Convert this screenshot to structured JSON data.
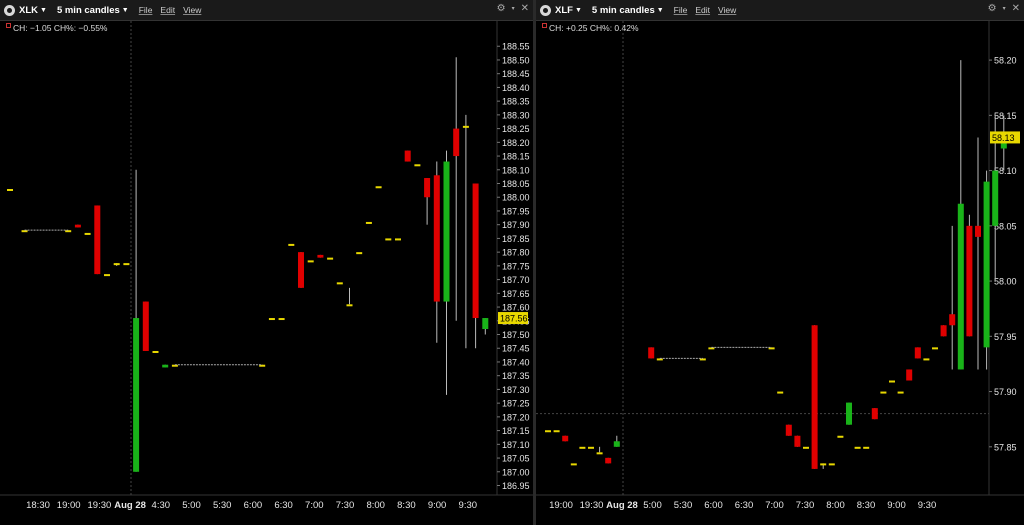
{
  "left_panel": {
    "symbol": "XLK",
    "period": "5 min candles",
    "menu": [
      "File",
      "Edit",
      "View"
    ],
    "change_text": "CH: −1.05 CH%: −0.55%",
    "last_price_label": "187.56",
    "y_ticks": [
      "188.55",
      "188.50",
      "188.45",
      "188.40",
      "188.35",
      "188.30",
      "188.25",
      "188.20",
      "188.15",
      "188.10",
      "188.05",
      "188.00",
      "187.95",
      "187.90",
      "187.85",
      "187.80",
      "187.75",
      "187.70",
      "187.65",
      "187.60",
      "187.55",
      "187.50",
      "187.45",
      "187.40",
      "187.35",
      "187.30",
      "187.25",
      "187.20",
      "187.15",
      "187.10",
      "187.05",
      "187.00",
      "186.95"
    ],
    "x_ticks": [
      "18:30",
      "19:00",
      "19:30",
      "Aug 28",
      "4:30",
      "5:00",
      "5:30",
      "6:00",
      "6:30",
      "7:00",
      "7:30",
      "8:00",
      "8:30",
      "9:00",
      "9:30"
    ]
  },
  "right_panel": {
    "symbol": "XLF",
    "period": "5 min candles",
    "menu": [
      "File",
      "Edit",
      "View"
    ],
    "change_text": "CH: +0.25 CH%: 0.42%",
    "last_price_label": "58.13",
    "y_ticks": [
      "58.20",
      "58.15",
      "58.10",
      "58.05",
      "58.00",
      "57.95",
      "57.90",
      "57.85"
    ],
    "x_ticks": [
      "19:00",
      "19:30",
      "Aug 28",
      "5:00",
      "5:30",
      "6:00",
      "6:30",
      "7:00",
      "7:30",
      "8:00",
      "8:30",
      "9:00",
      "9:30"
    ]
  },
  "colors": {
    "up": "#19b319",
    "down": "#e00000",
    "flat": "#e8d800",
    "last_price_bg": "#e8d800",
    "background": "#000000"
  },
  "icons": {
    "app": "app-logo-icon",
    "settings": "gear-icon",
    "close": "close-icon"
  },
  "chart_data": [
    {
      "type": "candlestick",
      "title": "XLK",
      "series": [
        {
          "name": "XLK",
          "values": [
            {
              "t": 0.0,
              "o": 188.03,
              "h": 188.03,
              "l": 188.03,
              "c": 188.03
            },
            {
              "t": 1.5,
              "o": 187.88,
              "h": 187.88,
              "l": 187.88,
              "c": 187.88
            },
            {
              "t": 6.0,
              "o": 187.88,
              "h": 187.88,
              "l": 187.88,
              "c": 187.88
            },
            {
              "t": 7.0,
              "o": 187.9,
              "h": 187.9,
              "l": 187.89,
              "c": 187.89
            },
            {
              "t": 8.0,
              "o": 187.87,
              "h": 187.87,
              "l": 187.87,
              "c": 187.87
            },
            {
              "t": 9.0,
              "o": 187.97,
              "h": 187.97,
              "l": 187.72,
              "c": 187.72
            },
            {
              "t": 10.0,
              "o": 187.72,
              "h": 187.72,
              "l": 187.72,
              "c": 187.72
            },
            {
              "t": 11.0,
              "o": 187.76,
              "h": 187.76,
              "l": 187.75,
              "c": 187.76
            },
            {
              "t": 12.0,
              "o": 187.76,
              "h": 187.76,
              "l": 187.76,
              "c": 187.76
            },
            {
              "t": 13.0,
              "o": 187.0,
              "h": 188.1,
              "l": 187.0,
              "c": 187.56
            },
            {
              "t": 14.0,
              "o": 187.62,
              "h": 187.62,
              "l": 187.44,
              "c": 187.44
            },
            {
              "t": 15.0,
              "o": 187.44,
              "h": 187.44,
              "l": 187.44,
              "c": 187.44
            },
            {
              "t": 16.0,
              "o": 187.38,
              "h": 187.39,
              "l": 187.38,
              "c": 187.39
            },
            {
              "t": 17.0,
              "o": 187.39,
              "h": 187.39,
              "l": 187.39,
              "c": 187.39
            },
            {
              "t": 26.0,
              "o": 187.39,
              "h": 187.39,
              "l": 187.39,
              "c": 187.39
            },
            {
              "t": 27.0,
              "o": 187.56,
              "h": 187.56,
              "l": 187.56,
              "c": 187.56
            },
            {
              "t": 28.0,
              "o": 187.56,
              "h": 187.56,
              "l": 187.56,
              "c": 187.56
            },
            {
              "t": 29.0,
              "o": 187.83,
              "h": 187.83,
              "l": 187.83,
              "c": 187.83
            },
            {
              "t": 30.0,
              "o": 187.8,
              "h": 187.8,
              "l": 187.67,
              "c": 187.67
            },
            {
              "t": 31.0,
              "o": 187.77,
              "h": 187.77,
              "l": 187.77,
              "c": 187.77
            },
            {
              "t": 32.0,
              "o": 187.79,
              "h": 187.79,
              "l": 187.78,
              "c": 187.78
            },
            {
              "t": 33.0,
              "o": 187.78,
              "h": 187.78,
              "l": 187.78,
              "c": 187.78
            },
            {
              "t": 34.0,
              "o": 187.69,
              "h": 187.69,
              "l": 187.69,
              "c": 187.69
            },
            {
              "t": 35.0,
              "o": 187.61,
              "h": 187.67,
              "l": 187.61,
              "c": 187.61
            },
            {
              "t": 36.0,
              "o": 187.8,
              "h": 187.8,
              "l": 187.8,
              "c": 187.8
            },
            {
              "t": 37.0,
              "o": 187.91,
              "h": 187.91,
              "l": 187.91,
              "c": 187.91
            },
            {
              "t": 38.0,
              "o": 188.04,
              "h": 188.04,
              "l": 188.04,
              "c": 188.04
            },
            {
              "t": 39.0,
              "o": 187.85,
              "h": 187.85,
              "l": 187.85,
              "c": 187.85
            },
            {
              "t": 40.0,
              "o": 187.85,
              "h": 187.85,
              "l": 187.85,
              "c": 187.85
            },
            {
              "t": 41.0,
              "o": 188.17,
              "h": 188.17,
              "l": 188.13,
              "c": 188.13
            },
            {
              "t": 42.0,
              "o": 188.12,
              "h": 188.12,
              "l": 188.12,
              "c": 188.12
            },
            {
              "t": 43.0,
              "o": 188.07,
              "h": 188.07,
              "l": 187.9,
              "c": 188.0
            },
            {
              "t": 44.0,
              "o": 188.08,
              "h": 188.13,
              "l": 187.47,
              "c": 187.62
            },
            {
              "t": 45.0,
              "o": 187.62,
              "h": 188.17,
              "l": 187.28,
              "c": 188.13
            },
            {
              "t": 46.0,
              "o": 188.25,
              "h": 188.51,
              "l": 187.55,
              "c": 188.15
            },
            {
              "t": 47.0,
              "o": 188.26,
              "h": 188.3,
              "l": 187.45,
              "c": 188.26
            },
            {
              "t": 48.0,
              "o": 188.05,
              "h": 188.05,
              "l": 187.45,
              "c": 187.56
            },
            {
              "t": 49.0,
              "o": 187.52,
              "h": 187.56,
              "l": 187.5,
              "c": 187.56
            }
          ]
        }
      ],
      "ylim": [
        186.93,
        188.58
      ]
    },
    {
      "type": "candlestick",
      "title": "XLF",
      "series": [
        {
          "name": "XLF",
          "values": [
            {
              "t": 0.0,
              "o": 57.865,
              "h": 57.865,
              "l": 57.865,
              "c": 57.865
            },
            {
              "t": 1.0,
              "o": 57.865,
              "h": 57.865,
              "l": 57.865,
              "c": 57.865
            },
            {
              "t": 2.0,
              "o": 57.86,
              "h": 57.86,
              "l": 57.855,
              "c": 57.855
            },
            {
              "t": 3.0,
              "o": 57.835,
              "h": 57.835,
              "l": 57.835,
              "c": 57.835
            },
            {
              "t": 4.0,
              "o": 57.85,
              "h": 57.85,
              "l": 57.85,
              "c": 57.85
            },
            {
              "t": 5.0,
              "o": 57.85,
              "h": 57.85,
              "l": 57.85,
              "c": 57.85
            },
            {
              "t": 6.0,
              "o": 57.845,
              "h": 57.85,
              "l": 57.845,
              "c": 57.845
            },
            {
              "t": 7.0,
              "o": 57.84,
              "h": 57.84,
              "l": 57.835,
              "c": 57.835
            },
            {
              "t": 8.0,
              "o": 57.85,
              "h": 57.86,
              "l": 57.85,
              "c": 57.855
            },
            {
              "t": 12.0,
              "o": 57.94,
              "h": 57.94,
              "l": 57.93,
              "c": 57.93
            },
            {
              "t": 13.0,
              "o": 57.93,
              "h": 57.93,
              "l": 57.93,
              "c": 57.93
            },
            {
              "t": 18.0,
              "o": 57.93,
              "h": 57.93,
              "l": 57.93,
              "c": 57.93
            },
            {
              "t": 19.0,
              "o": 57.94,
              "h": 57.94,
              "l": 57.94,
              "c": 57.94
            },
            {
              "t": 26.0,
              "o": 57.94,
              "h": 57.94,
              "l": 57.94,
              "c": 57.94
            },
            {
              "t": 27.0,
              "o": 57.9,
              "h": 57.9,
              "l": 57.9,
              "c": 57.9
            },
            {
              "t": 28.0,
              "o": 57.87,
              "h": 57.87,
              "l": 57.86,
              "c": 57.86
            },
            {
              "t": 29.0,
              "o": 57.86,
              "h": 57.86,
              "l": 57.85,
              "c": 57.85
            },
            {
              "t": 30.0,
              "o": 57.85,
              "h": 57.85,
              "l": 57.85,
              "c": 57.85
            },
            {
              "t": 31.0,
              "o": 57.96,
              "h": 57.96,
              "l": 57.83,
              "c": 57.83
            },
            {
              "t": 32.0,
              "o": 57.835,
              "h": 57.835,
              "l": 57.83,
              "c": 57.835
            },
            {
              "t": 33.0,
              "o": 57.835,
              "h": 57.835,
              "l": 57.835,
              "c": 57.835
            },
            {
              "t": 34.0,
              "o": 57.86,
              "h": 57.86,
              "l": 57.86,
              "c": 57.86
            },
            {
              "t": 35.0,
              "o": 57.87,
              "h": 57.89,
              "l": 57.87,
              "c": 57.89
            },
            {
              "t": 36.0,
              "o": 57.85,
              "h": 57.85,
              "l": 57.85,
              "c": 57.85
            },
            {
              "t": 37.0,
              "o": 57.85,
              "h": 57.85,
              "l": 57.85,
              "c": 57.85
            },
            {
              "t": 38.0,
              "o": 57.885,
              "h": 57.885,
              "l": 57.875,
              "c": 57.875
            },
            {
              "t": 39.0,
              "o": 57.9,
              "h": 57.9,
              "l": 57.9,
              "c": 57.9
            },
            {
              "t": 40.0,
              "o": 57.91,
              "h": 57.91,
              "l": 57.91,
              "c": 57.91
            },
            {
              "t": 41.0,
              "o": 57.9,
              "h": 57.9,
              "l": 57.9,
              "c": 57.9
            },
            {
              "t": 42.0,
              "o": 57.92,
              "h": 57.92,
              "l": 57.91,
              "c": 57.91
            },
            {
              "t": 43.0,
              "o": 57.94,
              "h": 57.94,
              "l": 57.93,
              "c": 57.93
            },
            {
              "t": 44.0,
              "o": 57.93,
              "h": 57.93,
              "l": 57.93,
              "c": 57.93
            },
            {
              "t": 45.0,
              "o": 57.94,
              "h": 57.94,
              "l": 57.94,
              "c": 57.94
            },
            {
              "t": 46.0,
              "o": 57.96,
              "h": 57.96,
              "l": 57.95,
              "c": 57.95
            },
            {
              "t": 47.0,
              "o": 57.97,
              "h": 58.05,
              "l": 57.92,
              "c": 57.96
            },
            {
              "t": 48.0,
              "o": 57.92,
              "h": 58.2,
              "l": 57.92,
              "c": 58.07
            },
            {
              "t": 49.0,
              "o": 58.05,
              "h": 58.06,
              "l": 57.95,
              "c": 57.95
            },
            {
              "t": 50.0,
              "o": 58.05,
              "h": 58.13,
              "l": 57.92,
              "c": 58.04
            },
            {
              "t": 51.0,
              "o": 57.94,
              "h": 58.1,
              "l": 57.92,
              "c": 58.09
            },
            {
              "t": 52.0,
              "o": 58.05,
              "h": 58.15,
              "l": 58.0,
              "c": 58.1
            },
            {
              "t": 53.0,
              "o": 58.12,
              "h": 58.15,
              "l": 58.1,
              "c": 58.13
            }
          ]
        }
      ],
      "ylim": [
        57.81,
        58.22
      ]
    }
  ]
}
